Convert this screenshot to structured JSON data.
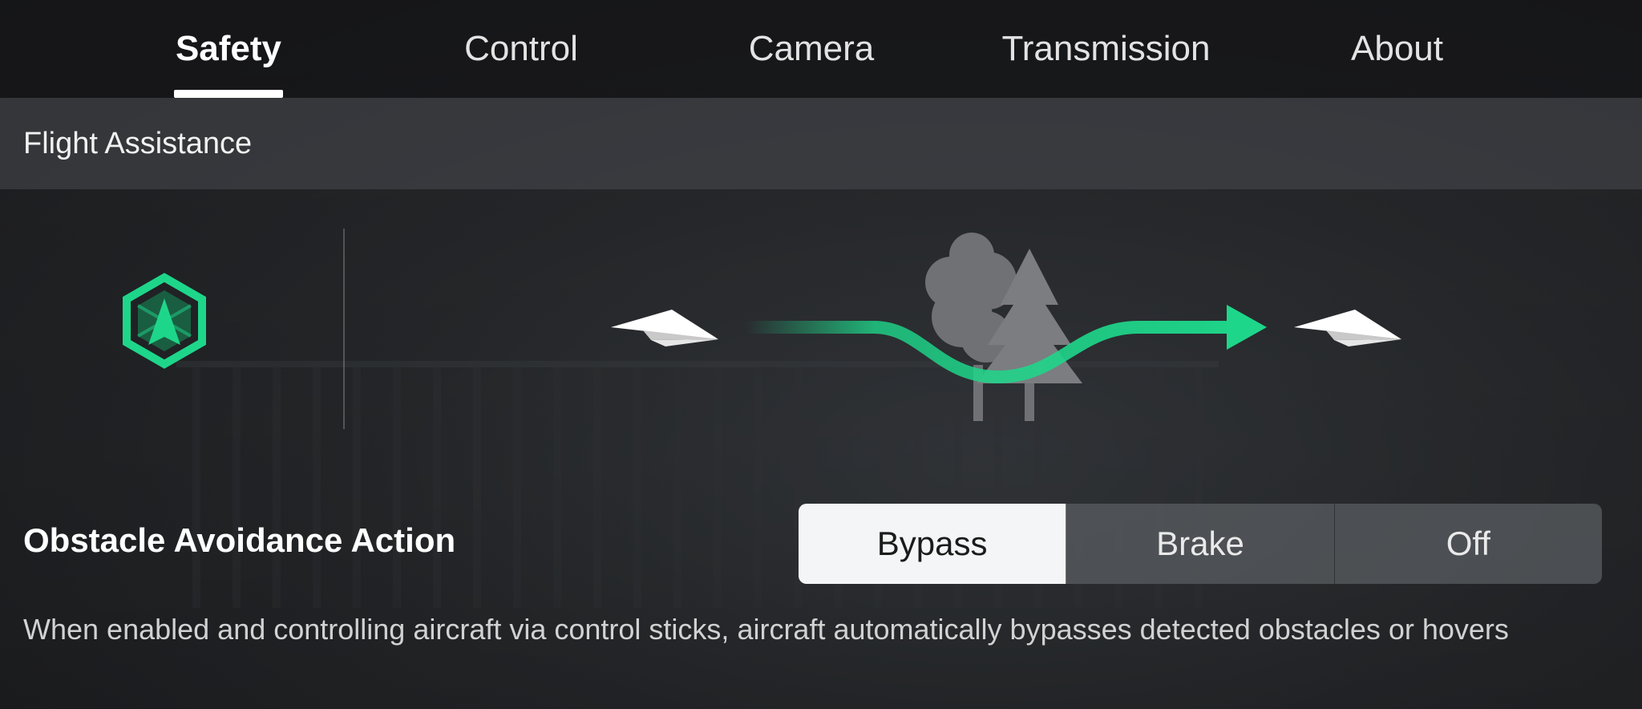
{
  "tabs": [
    {
      "label": "Safety",
      "active": true
    },
    {
      "label": "Control",
      "active": false
    },
    {
      "label": "Camera",
      "active": false
    },
    {
      "label": "Transmission",
      "active": false
    },
    {
      "label": "About",
      "active": false
    }
  ],
  "section": {
    "title": "Flight Assistance"
  },
  "illustration": {
    "icons": [
      "obstacle-avoidance-hex-icon",
      "paper-plane-icon",
      "tree-obstacle-icon",
      "bypass-path-arrow-icon"
    ],
    "accent_color": "#1ed68a"
  },
  "obstacle_avoidance": {
    "label": "Obstacle Avoidance Action",
    "options": [
      "Bypass",
      "Brake",
      "Off"
    ],
    "selected": "Bypass",
    "description": "When enabled and controlling aircraft via control sticks, aircraft automatically bypasses detected obstacles or hovers"
  }
}
